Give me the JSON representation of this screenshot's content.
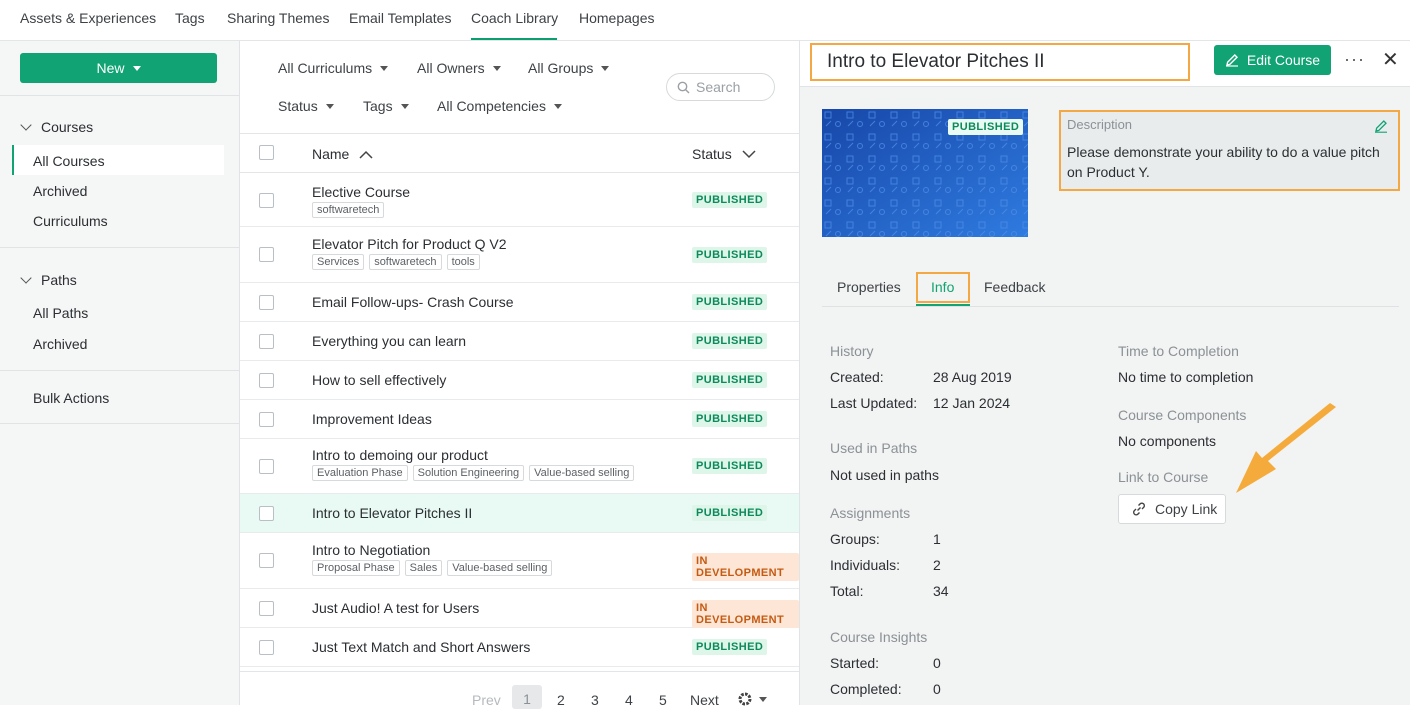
{
  "topnav": {
    "tabs": [
      "Assets & Experiences",
      "Tags",
      "Sharing Themes",
      "Email Templates",
      "Coach Library",
      "Homepages"
    ],
    "active": "Coach Library"
  },
  "sidebar": {
    "new_label": "New",
    "courses_heading": "Courses",
    "course_items": [
      "All Courses",
      "Archived",
      "Curriculums"
    ],
    "paths_heading": "Paths",
    "path_items": [
      "All Paths",
      "Archived"
    ],
    "bulk": "Bulk Actions"
  },
  "filters": {
    "curriculums": "All Curriculums",
    "owners": "All Owners",
    "groups": "All Groups",
    "status": "Status",
    "tags": "Tags",
    "competencies": "All Competencies",
    "search_placeholder": "Search"
  },
  "table": {
    "col_name": "Name",
    "col_status": "Status",
    "rows": [
      {
        "name": "Elective Course",
        "tags": [
          "softwaretech"
        ],
        "status": "PUBLISHED"
      },
      {
        "name": "Elevator Pitch for Product Q V2",
        "tags": [
          "Services",
          "softwaretech",
          "tools"
        ],
        "status": "PUBLISHED"
      },
      {
        "name": "Email Follow-ups- Crash Course",
        "tags": [],
        "status": "PUBLISHED"
      },
      {
        "name": "Everything you can learn",
        "tags": [],
        "status": "PUBLISHED"
      },
      {
        "name": "How to sell effectively",
        "tags": [],
        "status": "PUBLISHED"
      },
      {
        "name": "Improvement Ideas",
        "tags": [],
        "status": "PUBLISHED"
      },
      {
        "name": "Intro to demoing our product",
        "tags": [
          "Evaluation Phase",
          "Solution Engineering",
          "Value-based selling"
        ],
        "status": "PUBLISHED"
      },
      {
        "name": "Intro to Elevator Pitches II",
        "tags": [],
        "status": "PUBLISHED",
        "selected": true
      },
      {
        "name": "Intro to Negotiation",
        "tags": [
          "Proposal Phase",
          "Sales",
          "Value-based selling"
        ],
        "status": "IN DEVELOPMENT"
      },
      {
        "name": "Just Audio! A test for Users",
        "tags": [],
        "status": "IN DEVELOPMENT"
      },
      {
        "name": "Just Text Match and Short Answers",
        "tags": [],
        "status": "PUBLISHED"
      }
    ]
  },
  "pager": {
    "prev": "Prev",
    "pages": [
      "1",
      "2",
      "3",
      "4",
      "5"
    ],
    "current": "1",
    "next": "Next"
  },
  "detail": {
    "title": "Intro to Elevator Pitches II",
    "edit_label": "Edit Course",
    "thumb_badge": "PUBLISHED",
    "description_label": "Description",
    "description": "Please demonstrate your ability to do a value pitch on Product Y.",
    "tabs": [
      "Properties",
      "Info",
      "Feedback"
    ],
    "active_tab": "Info",
    "history_label": "History",
    "created_label": "Created:",
    "created": "28 Aug 2019",
    "updated_label": "Last Updated:",
    "updated": "12 Jan 2024",
    "used_label": "Used in Paths",
    "used": "Not used in paths",
    "assign_label": "Assignments",
    "groups_label": "Groups:",
    "groups": "1",
    "indiv_label": "Individuals:",
    "indiv": "2",
    "total_label": "Total:",
    "total": "34",
    "insights_label": "Course Insights",
    "started_label": "Started:",
    "started": "0",
    "completed_label": "Completed:",
    "completed": "0",
    "ttc_label": "Time to Completion",
    "ttc": "No time to completion",
    "components_label": "Course Components",
    "components": "No components",
    "link_label": "Link to Course",
    "copy_label": "Copy Link"
  },
  "colors": {
    "accent": "#11a373",
    "highlight": "#f3a843",
    "arrow": "#f5ab3c"
  }
}
